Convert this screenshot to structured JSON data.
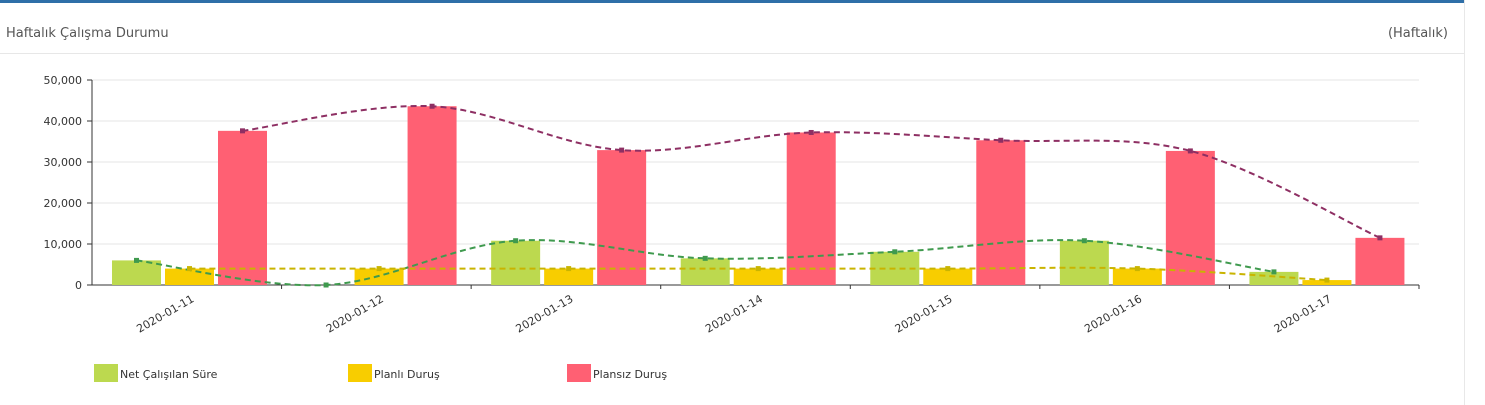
{
  "panel": {
    "title": "Haftalık Çalışma Durumu",
    "period": "(Haftalık)"
  },
  "chart_data": {
    "type": "bar",
    "categories": [
      "2020-01-11",
      "2020-01-12",
      "2020-01-13",
      "2020-01-14",
      "2020-01-15",
      "2020-01-16",
      "2020-01-17"
    ],
    "series": [
      {
        "name": "Net Çalışılan Süre",
        "color": "#bcd94f",
        "line_color": "#3f9a4e",
        "values": [
          6000,
          0,
          10800,
          6500,
          8100,
          10800,
          3200
        ]
      },
      {
        "name": "Planlı Duruş",
        "color": "#f8cd00",
        "line_color": "#c9b400",
        "values": [
          4000,
          4000,
          4000,
          4000,
          4000,
          4000,
          1200
        ]
      },
      {
        "name": "Plansız Duruş",
        "color": "#ff6073",
        "line_color": "#8e2f63",
        "values": [
          37600,
          43600,
          32900,
          37200,
          35300,
          32700,
          11500
        ]
      }
    ],
    "yticks": [
      "0",
      "10,000",
      "20,000",
      "30,000",
      "40,000",
      "50,000"
    ],
    "ylim": [
      0,
      50000
    ],
    "grid": true,
    "legend_position": "bottom-left",
    "trend_lines": "dashed smooth line per series"
  }
}
